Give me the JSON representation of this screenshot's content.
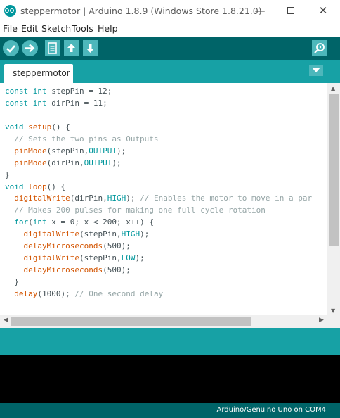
{
  "window": {
    "title": "steppermotor | Arduino 1.8.9 (Windows Store 1.8.21.0)",
    "minimize_glyph": "—",
    "close_glyph": "✕"
  },
  "menu": {
    "items": [
      {
        "label": "File"
      },
      {
        "label": "Edit"
      },
      {
        "label": "Sketch"
      },
      {
        "label": "Tools"
      },
      {
        "label": "Help"
      }
    ]
  },
  "toolbar": {
    "icons": [
      "verify-icon",
      "upload-icon",
      "new-icon",
      "open-icon",
      "save-icon",
      "serial-monitor-icon"
    ]
  },
  "tabs": [
    {
      "label": "steppermotor",
      "active": true
    }
  ],
  "editor": {
    "lines": [
      [
        {
          "t": "const",
          "c": "kw"
        },
        {
          "t": " "
        },
        {
          "t": "int",
          "c": "kw"
        },
        {
          "t": " stepPin = 12;"
        }
      ],
      [
        {
          "t": "const",
          "c": "kw"
        },
        {
          "t": " "
        },
        {
          "t": "int",
          "c": "kw"
        },
        {
          "t": " dirPin = 11;"
        }
      ],
      [
        {
          "t": ""
        }
      ],
      [
        {
          "t": "void",
          "c": "kw"
        },
        {
          "t": " "
        },
        {
          "t": "setup",
          "c": "fn"
        },
        {
          "t": "() {"
        }
      ],
      [
        {
          "t": "  "
        },
        {
          "t": "// Sets the two pins as Outputs",
          "c": "cm"
        }
      ],
      [
        {
          "t": "  "
        },
        {
          "t": "pinMode",
          "c": "fn"
        },
        {
          "t": "(stepPin,"
        },
        {
          "t": "OUTPUT",
          "c": "cst"
        },
        {
          "t": ");"
        }
      ],
      [
        {
          "t": "  "
        },
        {
          "t": "pinMode",
          "c": "fn"
        },
        {
          "t": "(dirPin,"
        },
        {
          "t": "OUTPUT",
          "c": "cst"
        },
        {
          "t": ");"
        }
      ],
      [
        {
          "t": "}"
        }
      ],
      [
        {
          "t": "void",
          "c": "kw"
        },
        {
          "t": " "
        },
        {
          "t": "loop",
          "c": "fn"
        },
        {
          "t": "() {"
        }
      ],
      [
        {
          "t": "  "
        },
        {
          "t": "digitalWrite",
          "c": "fn"
        },
        {
          "t": "(dirPin,"
        },
        {
          "t": "HIGH",
          "c": "cst"
        },
        {
          "t": "); "
        },
        {
          "t": "// Enables the motor to move in a par",
          "c": "cm"
        }
      ],
      [
        {
          "t": "  "
        },
        {
          "t": "// Makes 200 pulses for making one full cycle rotation",
          "c": "cm"
        }
      ],
      [
        {
          "t": "  "
        },
        {
          "t": "for",
          "c": "kw"
        },
        {
          "t": "("
        },
        {
          "t": "int",
          "c": "kw"
        },
        {
          "t": " x = 0; x < 200; x++) {"
        }
      ],
      [
        {
          "t": "    "
        },
        {
          "t": "digitalWrite",
          "c": "fn"
        },
        {
          "t": "(stepPin,"
        },
        {
          "t": "HIGH",
          "c": "cst"
        },
        {
          "t": ");"
        }
      ],
      [
        {
          "t": "    "
        },
        {
          "t": "delayMicroseconds",
          "c": "fn"
        },
        {
          "t": "(500);"
        }
      ],
      [
        {
          "t": "    "
        },
        {
          "t": "digitalWrite",
          "c": "fn"
        },
        {
          "t": "(stepPin,"
        },
        {
          "t": "LOW",
          "c": "cst"
        },
        {
          "t": ");"
        }
      ],
      [
        {
          "t": "    "
        },
        {
          "t": "delayMicroseconds",
          "c": "fn"
        },
        {
          "t": "(500);"
        }
      ],
      [
        {
          "t": "  }"
        }
      ],
      [
        {
          "t": "  "
        },
        {
          "t": "delay",
          "c": "fn"
        },
        {
          "t": "(1000); "
        },
        {
          "t": "// One second delay",
          "c": "cm"
        }
      ],
      [
        {
          "t": ""
        }
      ],
      [
        {
          "t": "  "
        },
        {
          "t": "digitalWrite",
          "c": "fn"
        },
        {
          "t": "(dirPin,"
        },
        {
          "t": "LOW",
          "c": "cst"
        },
        {
          "t": "); "
        },
        {
          "t": "//Changes the rotations direction",
          "c": "cm"
        }
      ]
    ]
  },
  "scrollbars": {
    "up": "▲",
    "down": "▼",
    "left": "◀",
    "right": "▶"
  },
  "status": {
    "board": "Arduino/Genuino Uno on COM4"
  },
  "colors": {
    "toolbar": "#006468",
    "tabstrip": "#17a1a5",
    "button": "#4db7bb",
    "keyword": "#00979c",
    "function": "#d35400",
    "comment": "#95a5a6"
  }
}
